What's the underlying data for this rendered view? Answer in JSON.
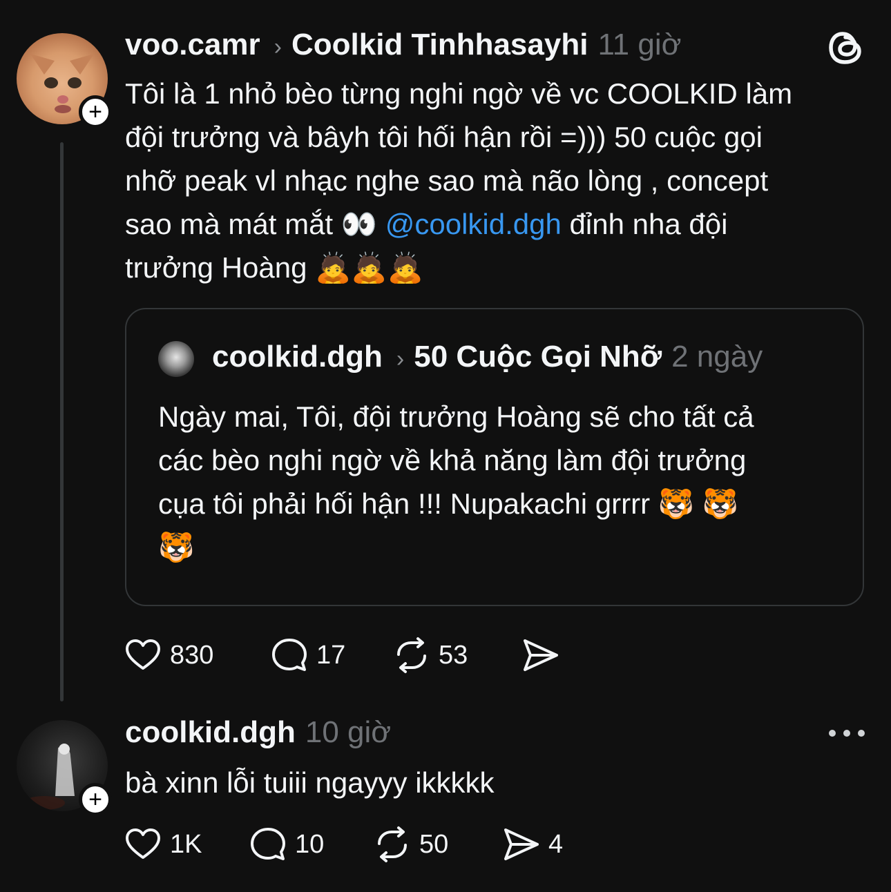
{
  "post": {
    "username": "voo.camr",
    "reply_to": "Coolkid Tinhhasayhi",
    "time": "11 giờ",
    "text_before_mention": "Tôi là 1 nhỏ bèo từng nghi ngờ về vc COOLKID làm\nđội trưởng và bâyh tôi hối hận rồi =))) 50 cuộc gọi\nnhỡ peak vl nhạc nghe sao mà não lòng , concept\nsao mà mát mắt 👀 ",
    "mention": "@coolkid.dgh",
    "text_after_mention": " đỉnh nha đội\ntrưởng Hoàng 🙇🙇🙇",
    "actions": {
      "likes": "830",
      "comments": "17",
      "reposts": "53"
    }
  },
  "quoted_post": {
    "username": "coolkid.dgh",
    "reply_to": "50 Cuộc Gọi Nhỡ",
    "time": "2 ngày",
    "text": "Ngày mai, Tôi, đội trưởng Hoàng sẽ cho tất cả\ncác bèo nghi ngờ về khả năng làm đội trưởng\ncụa tôi phải hối hận !!! Nupakachi grrrr 🐯 🐯\n🐯"
  },
  "reply": {
    "username": "coolkid.dgh",
    "time": "10 giờ",
    "text": "bà xinn lỗi tuiii ngayyy ikkkkk",
    "actions": {
      "likes": "1K",
      "comments": "10",
      "reposts": "50",
      "shares": "4"
    }
  },
  "icons": {
    "follow": "+",
    "logo": "threads-logo-icon",
    "more": "more-icon"
  },
  "colors": {
    "background": "#101010",
    "mention": "#3897f0",
    "muted": "#6f7276"
  }
}
